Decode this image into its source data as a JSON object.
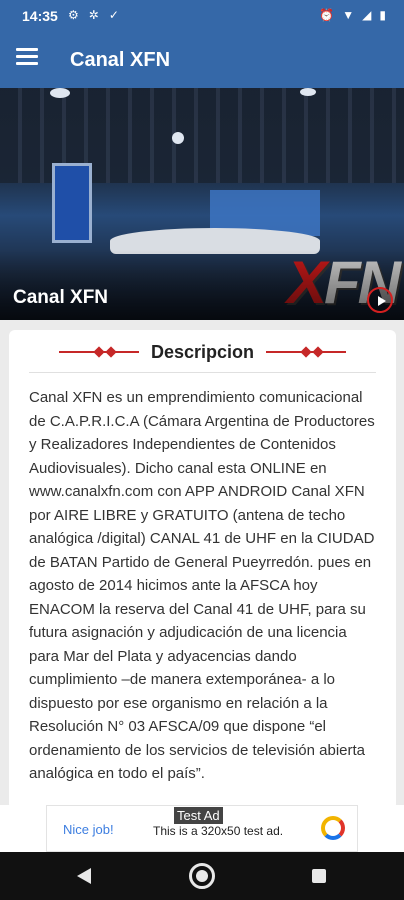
{
  "status_bar": {
    "time": "14:35",
    "left_icons": [
      "settings-sync-icon",
      "settings-icon",
      "check-download-icon"
    ],
    "right_icons": [
      "alarm-icon",
      "wifi-icon",
      "signal-icon",
      "battery-icon"
    ]
  },
  "app_bar": {
    "title": "Canal XFN",
    "menu_icon": "hamburger-menu-icon"
  },
  "hero": {
    "title": "Canal XFN",
    "logo_text": "XFN"
  },
  "description": {
    "heading": "Descripcion",
    "body": "Canal XFN es un emprendimiento comunicacional de C.A.P.R.I.C.A (Cámara Argentina de Productores y Realizadores Independientes de Contenidos Audiovisuales). Dicho canal esta ONLINE en www.canalxfn.com con APP ANDROID Canal XFN por AIRE LIBRE y GRATUITO (antena de techo analógica /digital) CANAL 41 de UHF en la CIUDAD de BATAN Partido de General Pueyrredón. pues en agosto de 2014 hicimos ante la AFSCA hoy ENACOM la reserva del Canal 41 de UHF, para su futura asignación y adjudicación de una licencia para Mar del Plata y adyacencias dando cumplimiento –de manera extemporánea- a lo dispuesto por ese organismo en relación a la Resolución N° 03 AFSCA/09 que dispone “el ordenamiento de los servicios de televisión abierta analógica en todo el país”."
  },
  "ad": {
    "tag": "Test Ad",
    "nice_job": "Nice job!",
    "text": "This is a 320x50 test ad."
  },
  "colors": {
    "primary": "#3568a8",
    "accent": "#c62828"
  }
}
